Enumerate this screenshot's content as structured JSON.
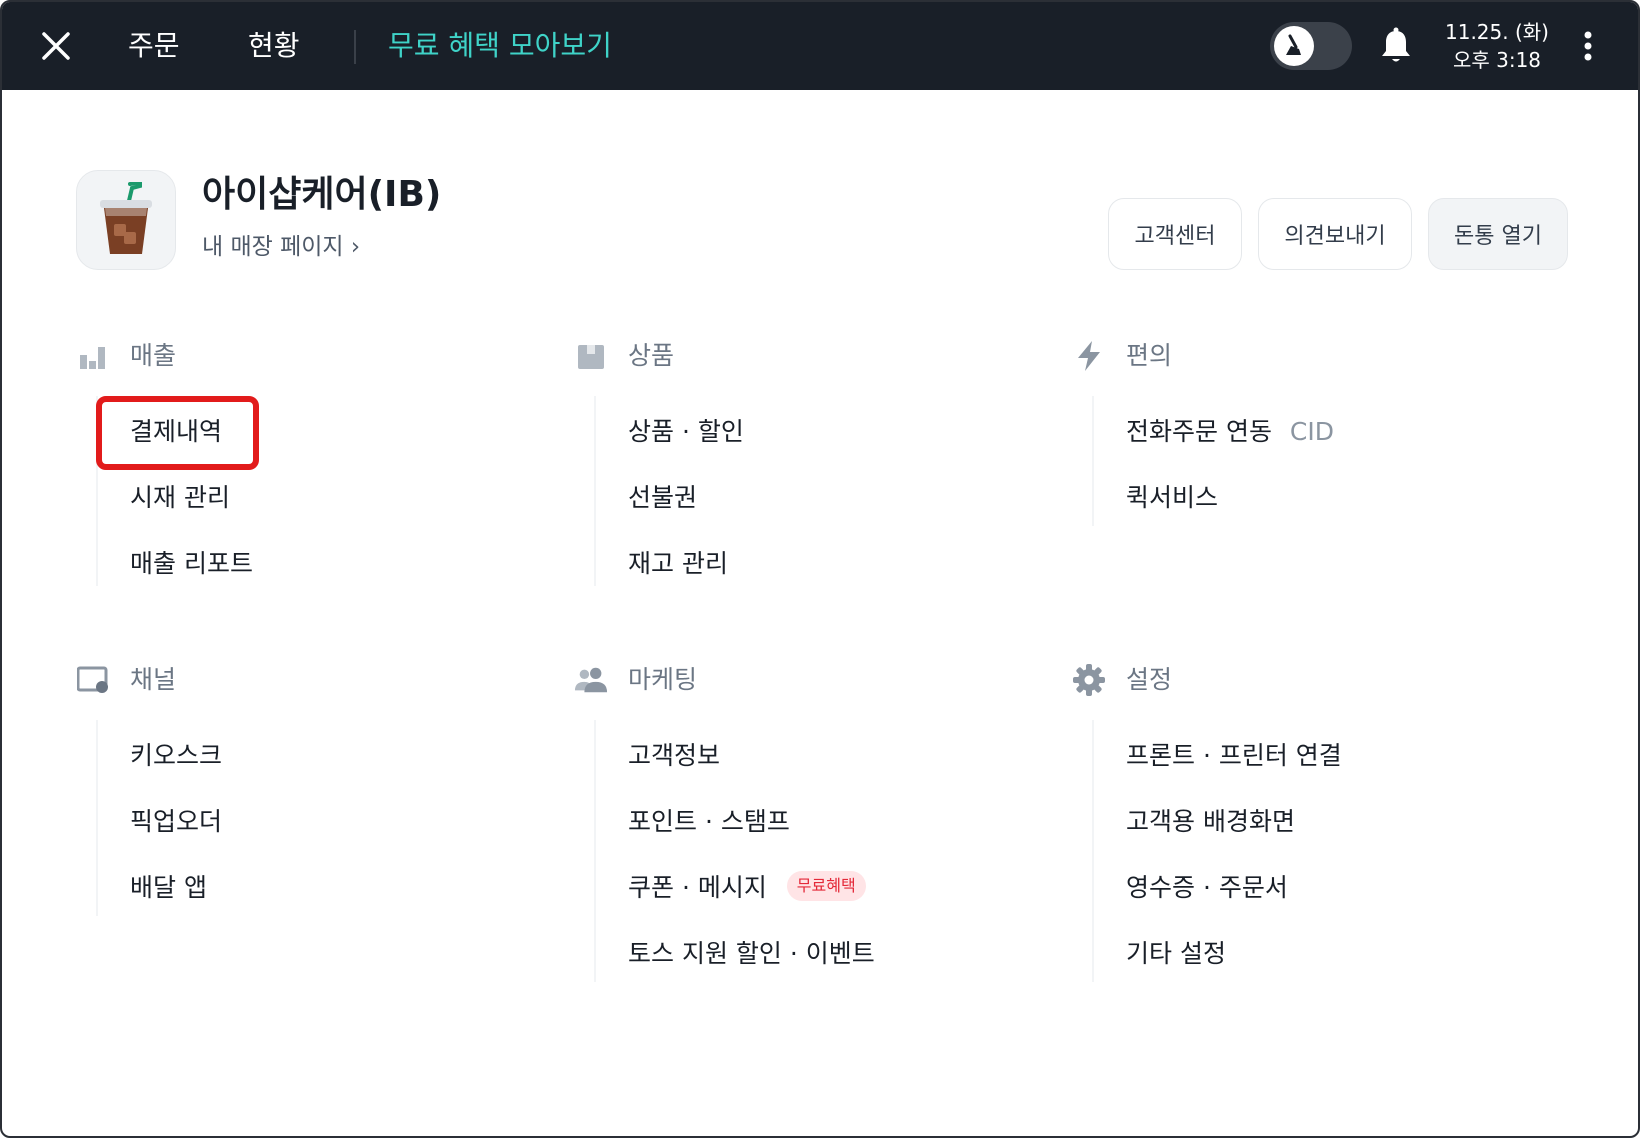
{
  "topbar": {
    "tabs": [
      {
        "label": "주문"
      },
      {
        "label": "현황"
      },
      {
        "label": "무료 혜택 모아보기"
      }
    ],
    "date": "11.25. (화)",
    "time": "오후 3:18"
  },
  "store": {
    "name": "아이샵케어(IB)",
    "page_link": "내 매장 페이지 ›"
  },
  "header_buttons": {
    "support": "고객센터",
    "feedback": "의견보내기",
    "cash_drawer": "돈통 열기"
  },
  "sections": {
    "sales": {
      "title": "매출",
      "items": [
        "결제내역",
        "시재 관리",
        "매출 리포트"
      ]
    },
    "products": {
      "title": "상품",
      "items": [
        "상품 · 할인",
        "선불권",
        "재고 관리"
      ]
    },
    "convenience": {
      "title": "편의",
      "items": [
        "전화주문 연동",
        "퀵서비스"
      ],
      "cid": "CID"
    },
    "channel": {
      "title": "채널",
      "items": [
        "키오스크",
        "픽업오더",
        "배달 앱"
      ]
    },
    "marketing": {
      "title": "마케팅",
      "items": [
        "고객정보",
        "포인트 · 스탬프",
        "쿠폰 · 메시지",
        "토스 지원 할인 · 이벤트"
      ],
      "badge": "무료혜택"
    },
    "settings": {
      "title": "설정",
      "items": [
        "프론트 · 프린터 연결",
        "고객용 배경화면",
        "영수증 · 주문서",
        "기타 설정"
      ]
    }
  },
  "colors": {
    "topbar_bg": "#191f28",
    "promo_tab": "#3fd3c8",
    "highlight": "#e21b1b",
    "badge_bg": "#ffe4e6",
    "badge_text": "#e42939"
  }
}
